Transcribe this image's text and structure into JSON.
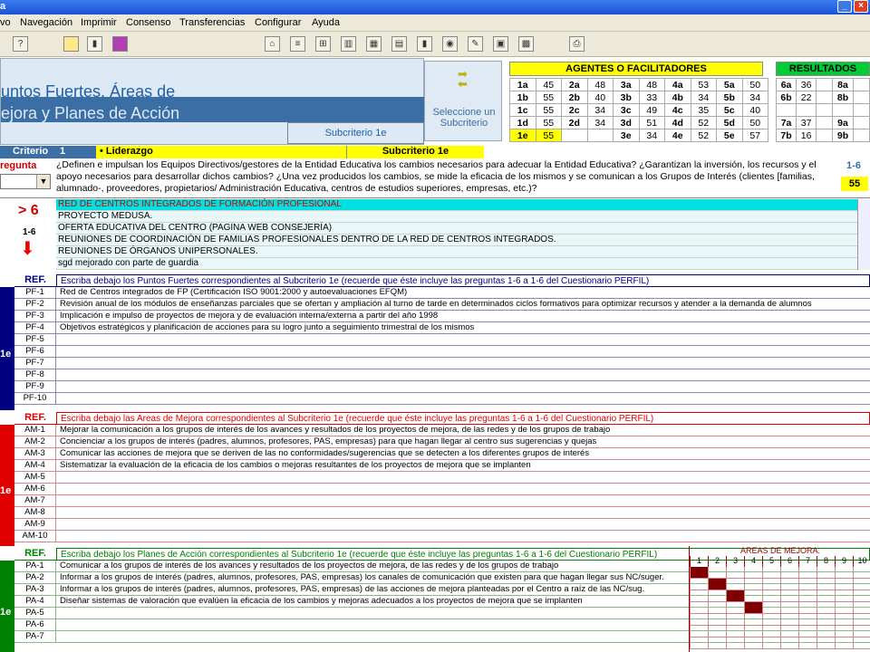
{
  "window": {
    "title": "a",
    "min": "_",
    "close": "×"
  },
  "menu": [
    "vo",
    "Navegación",
    "Imprimir",
    "Consenso",
    "Transferencias",
    "Configurar",
    "Ayuda"
  ],
  "header": {
    "line1": "untos Fuertes, Áreas de",
    "line2": "ejora y Planes de Acción",
    "subcriterio": "Subcriterio 1e"
  },
  "select_button": {
    "label": "Seleccione un Subcriterio"
  },
  "agents": {
    "title": "AGENTES O FACILITADORES",
    "rows": [
      [
        "1a",
        "45",
        "2a",
        "48",
        "3a",
        "48",
        "4a",
        "53",
        "5a",
        "50"
      ],
      [
        "1b",
        "55",
        "2b",
        "40",
        "3b",
        "33",
        "4b",
        "34",
        "5b",
        "34"
      ],
      [
        "1c",
        "55",
        "2c",
        "34",
        "3c",
        "49",
        "4c",
        "35",
        "5c",
        "40"
      ],
      [
        "1d",
        "55",
        "2d",
        "34",
        "3d",
        "51",
        "4d",
        "52",
        "5d",
        "50"
      ],
      [
        "1e",
        "55",
        "",
        "",
        "3e",
        "34",
        "4e",
        "52",
        "5e",
        "57"
      ]
    ]
  },
  "results": {
    "title": "RESULTADOS",
    "rows": [
      [
        "6a",
        "36",
        "",
        "8a",
        ""
      ],
      [
        "6b",
        "22",
        "",
        "8b",
        ""
      ],
      [
        "",
        "",
        "",
        "",
        ""
      ],
      [
        "7a",
        "37",
        "",
        "9a",
        ""
      ],
      [
        "7b",
        "16",
        "",
        "9b",
        ""
      ]
    ]
  },
  "criterio": {
    "label": "Criterio",
    "num": "1",
    "name": "• Liderazgo",
    "subcriterio": "Subcriterio 1e"
  },
  "question": {
    "label": "regunta",
    "text": "¿Definen e impulsan los Equipos Directivos/gestores de la Entidad Educativa los cambios necesarios para adecuar la Entidad Educativa? ¿Garantizan la inversión, los recursos y el apoyo necesarios para desarrollar dichos cambios? ¿Una vez producidos los cambios, se mide la eficacia de los mismos y se comunican  a los Grupos de Interés (clientes [familias, alumnado-, proveedores, propietarios/ Administración Educativa, centros de estudios superiores, empresas, etc.)?",
    "range": "1-6",
    "value": "55"
  },
  "evidence": {
    "gt": "> 6",
    "range": "1-6",
    "items": [
      "RED DE CENTROS INTEGRADOS DE FORMACIÓN PROFESIONAL",
      "PROYECTO MEDUSA.",
      "OFERTA EDUCATIVA DEL CENTRO (PAGINA WEB CONSEJERÍA)",
      "REUNIONES DE COORDINACIÓN DE FAMILIAS PROFESIONALES DENTRO DE LA RED DE CENTROS INTEGRADOS.",
      "REUNIONES DE ÓRGANOS UNIPERSONALES.",
      "sgd mejorado con parte de guardia"
    ]
  },
  "fortalezas": {
    "ref": "REF.",
    "side": "1e",
    "head": "Escriba debajo los Puntos Fuertes correspondientes al Subcriterio 1e (recuerde que éste incluye las preguntas 1-6 a 1-6 del Cuestionario PERFIL)",
    "rows": [
      [
        "PF-1",
        "Red de Centros integrados de FP (Certificación ISO 9001:2000 y autoevaluaciones EFQM)"
      ],
      [
        "PF-2",
        "Revisión anual de los módulos de enseñanzas parciales que se ofertan y ampliación al turno de tarde en determinados ciclos formativos para optimizar recursos y atender a la demanda de alumnos"
      ],
      [
        "PF-3",
        "Implicación e impulso de proyectos de mejora y de evaluación interna/externa a partir del año 1998"
      ],
      [
        "PF-4",
        "Objetivos estratégicos y planificación de acciones para su logro junto a seguimiento trimestral de los mismos"
      ],
      [
        "PF-5",
        ""
      ],
      [
        "PF-6",
        ""
      ],
      [
        "PF-7",
        ""
      ],
      [
        "PF-8",
        ""
      ],
      [
        "PF-9",
        ""
      ],
      [
        "PF-10",
        ""
      ]
    ]
  },
  "mejoras": {
    "ref": "REF.",
    "side": "1e",
    "head": "Escriba debajo las Areas de Mejora correspondientes al Subcriterio 1e (recuerde que éste incluye las preguntas 1-6 a 1-6 del Cuestionario PERFIL)",
    "rows": [
      [
        "AM-1",
        "Mejorar la comunicación a los grupos de interés de los avances y resultados de los proyectos de mejora, de las redes y de los grupos de trabajo"
      ],
      [
        "AM-2",
        "Concienciar a los grupos de interés (padres, alumnos, profesores, PAS, empresas) para que hagan llegar al centro sus sugerencias y quejas"
      ],
      [
        "AM-3",
        "Comunicar las acciones de mejora que se deriven de las no conformidades/sugerencias que se detecten a los diferentes grupos de interés"
      ],
      [
        "AM-4",
        "Sistematizar la evaluación de la eficacia de los cambios o mejoras resultantes de los proyectos de mejora que se implanten"
      ],
      [
        "AM-5",
        ""
      ],
      [
        "AM-6",
        ""
      ],
      [
        "AM-7",
        ""
      ],
      [
        "AM-8",
        ""
      ],
      [
        "AM-9",
        ""
      ],
      [
        "AM-10",
        ""
      ]
    ]
  },
  "planes": {
    "ref": "REF.",
    "side": "1e",
    "head": "Escriba debajo los Planes de Acción correspondientes al Subcriterio 1e (recuerde que éste incluye las preguntas 1-6 a 1-6 del Cuestionario PERFIL)",
    "rows": [
      [
        "PA-1",
        "Comunicar a los grupos de interés de los avances y resultados de los proyectos de mejora, de las redes y de los grupos de trabajo"
      ],
      [
        "PA-2",
        "Informar a los grupos de interés (padres, alumnos, profesores, PAS, empresas) los canales de comunicación que existen para que hagan llegar sus NC/suger."
      ],
      [
        "PA-3",
        "Informar a los grupos de interés (padres, alumnos, profesores, PAS, empresas) de las acciones de mejora planteadas por el Centro a raíz de las NC/sug."
      ],
      [
        "PA-4",
        "Diseñar sistemas de valoración que evalúen la eficacia de los cambios y mejoras adecuados a los proyectos de mejora que se implanten"
      ],
      [
        "PA-5",
        ""
      ],
      [
        "PA-6",
        ""
      ],
      [
        "PA-7",
        ""
      ]
    ]
  },
  "areas_grid": {
    "title": "AREAS DE MEJORA.",
    "cols": [
      "1",
      "2",
      "3",
      "4",
      "5",
      "6",
      "7",
      "8",
      "9",
      "10"
    ],
    "marks": [
      [
        0,
        0
      ],
      [
        1,
        1
      ],
      [
        2,
        2
      ],
      [
        3,
        3
      ]
    ]
  },
  "colors": {
    "pf": "#000080",
    "am": "#e00000",
    "pa": "#008000"
  }
}
